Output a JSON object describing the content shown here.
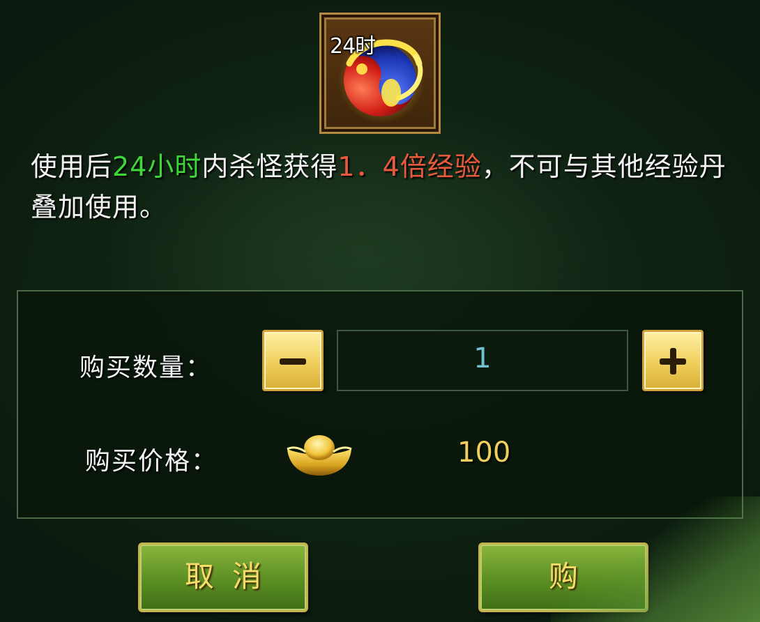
{
  "item": {
    "duration_badge": "24时",
    "icon": "yin-yang-orb-icon"
  },
  "description": {
    "part1": "使用后",
    "highlight_time": "24小时",
    "part2": "内杀怪获得",
    "highlight_multiplier": "1．4倍经验",
    "part3": "，不可与其他经验丹叠加使用。"
  },
  "purchase": {
    "quantity_label": "购买数量：",
    "quantity_value": "1",
    "decrease_icon": "minus-icon",
    "increase_icon": "plus-icon",
    "price_label": "购买价格：",
    "currency_icon": "gold-ingot-icon",
    "price_value": "100"
  },
  "buttons": {
    "cancel_label": "取消",
    "buy_label": "购"
  },
  "colors": {
    "highlight_green": "#3ed83b",
    "highlight_red": "#e9593d",
    "price_gold": "#f0d05c",
    "quantity_text": "#6ec1d1",
    "button_green": "#5b8e23"
  }
}
